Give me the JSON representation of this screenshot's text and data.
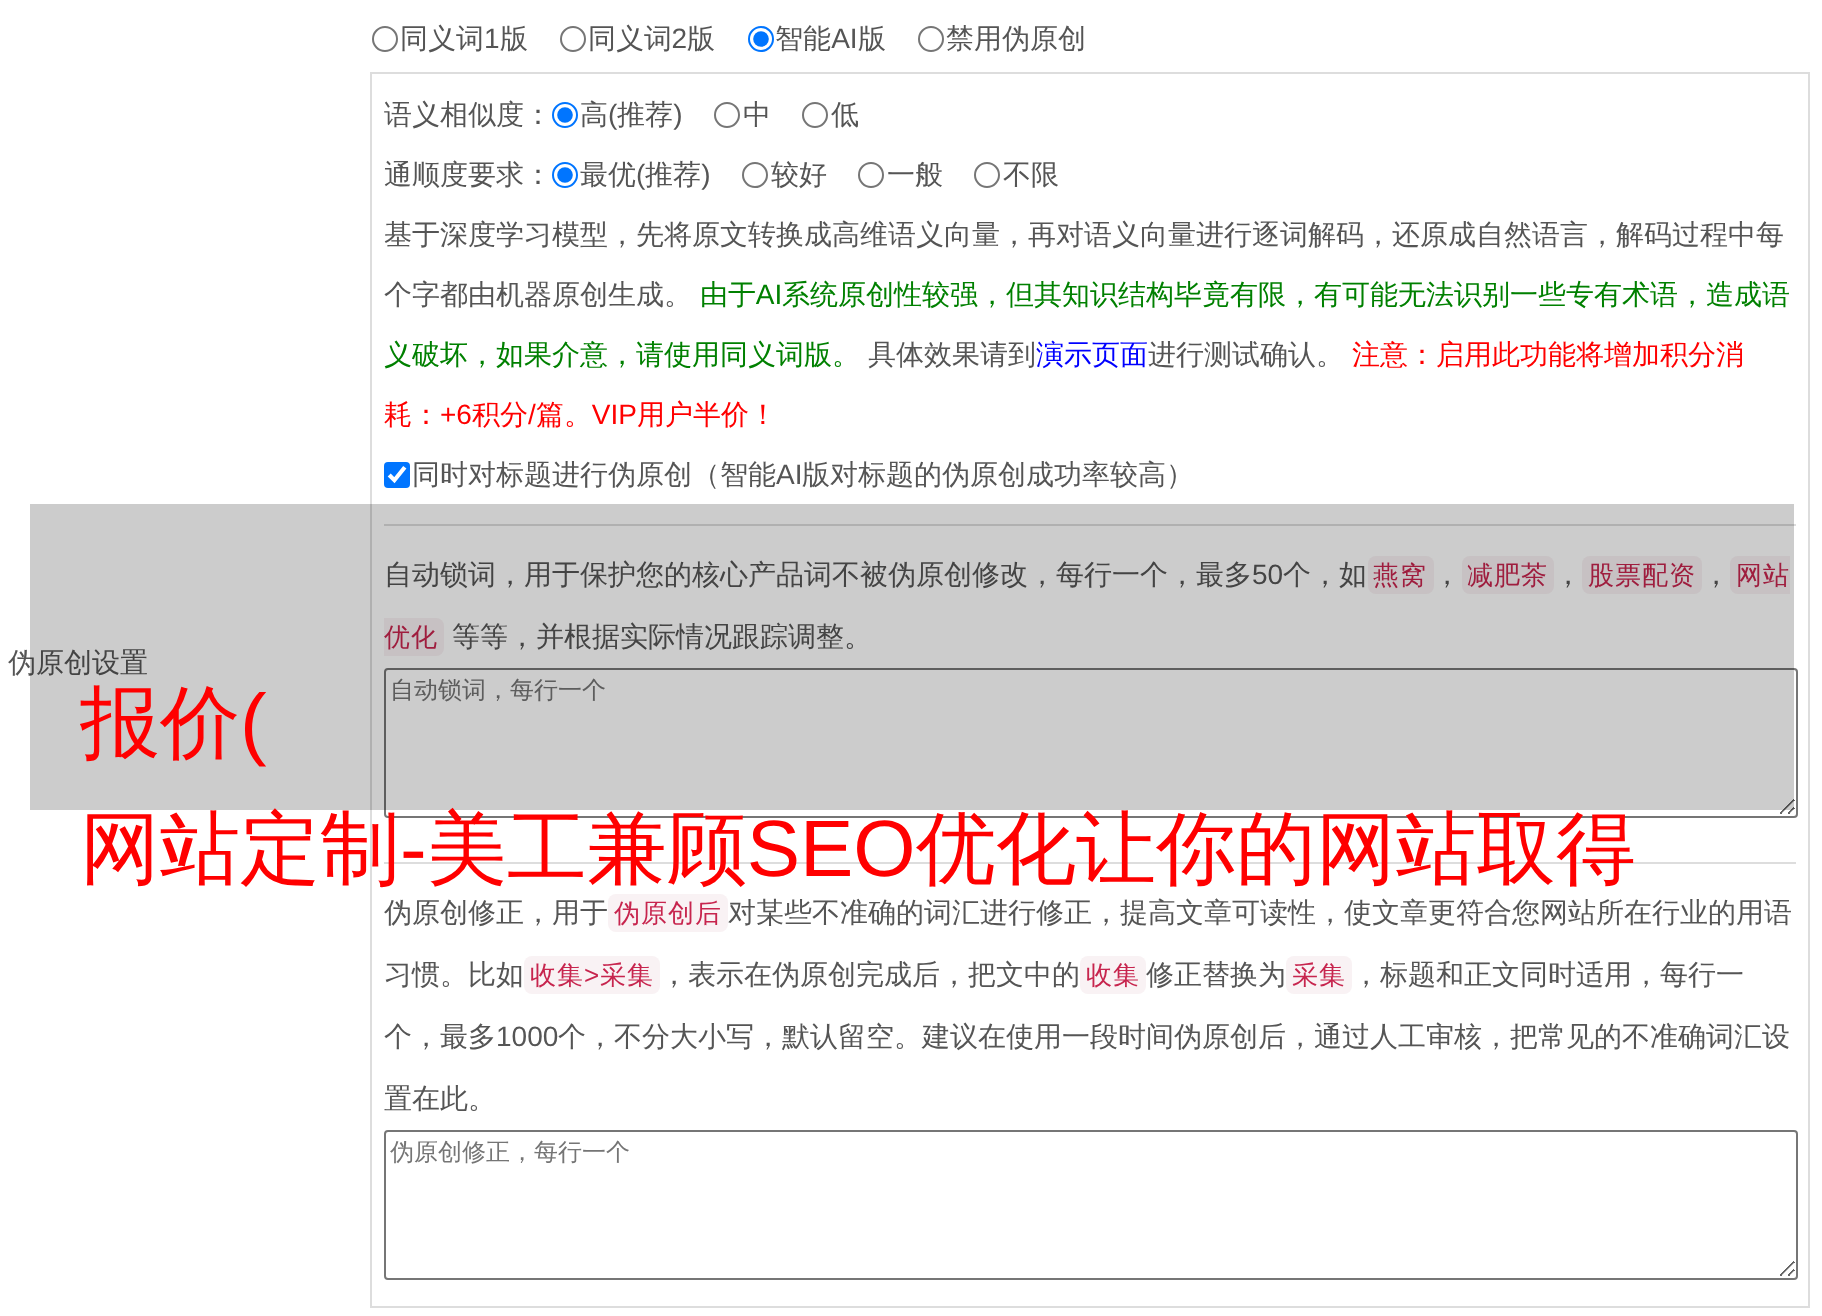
{
  "side_label": "伪原创设置",
  "modes": [
    {
      "label": "同义词1版",
      "selected": false
    },
    {
      "label": "同义词2版",
      "selected": false
    },
    {
      "label": "智能AI版",
      "selected": true
    },
    {
      "label": "禁用伪原创",
      "selected": false
    }
  ],
  "settings": [
    {
      "label": "语义相似度：",
      "options": [
        {
          "label": "高(推荐)",
          "selected": true
        },
        {
          "label": "中",
          "selected": false
        },
        {
          "label": "低",
          "selected": false
        }
      ]
    },
    {
      "label": "通顺度要求：",
      "options": [
        {
          "label": "最优(推荐)",
          "selected": true
        },
        {
          "label": "较好",
          "selected": false
        },
        {
          "label": "一般",
          "selected": false
        },
        {
          "label": "不限",
          "selected": false
        }
      ]
    }
  ],
  "description": [
    {
      "kind": "plain",
      "text": "基于深度学习模型，先将原文转换成高维语义向量，再对语义向量进行逐词解码，还原成自然语言，解码过程中每个字都由机器原创生成。 "
    },
    {
      "kind": "note",
      "text": "由于AI系统原创性较强，但其知识结构毕竟有限，有可能无法识别一些专有术语，造成语义破坏，如果介意，请使用同义词版。"
    },
    {
      "kind": "plain",
      "text": " 具体效果请到"
    },
    {
      "kind": "link",
      "text": "演示页面"
    },
    {
      "kind": "plain",
      "text": "进行测试确认。 "
    },
    {
      "kind": "warning",
      "text": "注意：启用此功能将增加积分消耗：+6积分/篇。VIP用户半价！"
    }
  ],
  "title_option": {
    "label": "同时对标题进行伪原创（智能AI版对标题的伪原创成功率较高）",
    "checked": true
  },
  "lock_words": {
    "description": [
      {
        "kind": "plain",
        "text": "自动锁词，用于保护您的核心产品词不被伪原创修改，每行一个，最多50个，如"
      },
      {
        "kind": "code",
        "text": "燕窝"
      },
      {
        "kind": "plain",
        "text": "，"
      },
      {
        "kind": "code",
        "text": "减肥茶"
      },
      {
        "kind": "plain",
        "text": "，"
      },
      {
        "kind": "code",
        "text": "股票配资"
      },
      {
        "kind": "plain",
        "text": "，"
      },
      {
        "kind": "code",
        "text": "网站优化"
      },
      {
        "kind": "plain",
        "text": " 等等，并根据实际情况跟踪调整。"
      }
    ],
    "placeholder": "自动锁词，每行一个"
  },
  "corrections": {
    "description": [
      {
        "kind": "plain",
        "text": "伪原创修正，用于"
      },
      {
        "kind": "code",
        "text": "伪原创后"
      },
      {
        "kind": "plain",
        "text": "对某些不准确的词汇进行修正，提高文章可读性，使文章更符合您网站所在行业的用语习惯。比如"
      },
      {
        "kind": "code",
        "text": "收集>采集"
      },
      {
        "kind": "plain",
        "text": "，表示在伪原创完成后，把文中的"
      },
      {
        "kind": "code",
        "text": "收集"
      },
      {
        "kind": "plain",
        "text": "修正替换为"
      },
      {
        "kind": "code",
        "text": "采集"
      },
      {
        "kind": "plain",
        "text": "，标题和正文同时适用，每行一个，最多1000个，不分大小写，默认留空。建议在使用一段时间伪原创后，通过人工审核，把常见的不准确词汇设置在此。"
      }
    ],
    "placeholder": "伪原创修正，每行一个"
  },
  "overlay": {
    "lines": [
      "报价(",
      "网站定制-美工兼顾SEO优化让你的网站取得"
    ]
  }
}
